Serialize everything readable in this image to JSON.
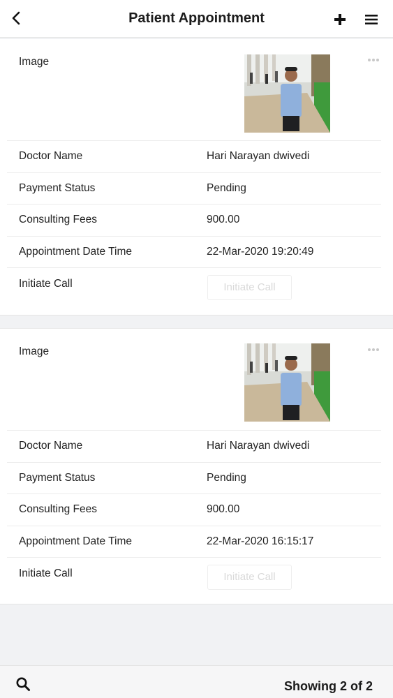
{
  "header": {
    "title": "Patient Appointment",
    "back_icon": "chevron-left-icon",
    "add_icon": "plus-icon",
    "menu_icon": "hamburger-menu-icon"
  },
  "labels": {
    "image": "Image",
    "doctor_name": "Doctor Name",
    "payment_status": "Payment Status",
    "consulting_fees": "Consulting Fees",
    "appointment_date_time": "Appointment Date Time",
    "initiate_call": "Initiate Call"
  },
  "appointments": [
    {
      "doctor_name": "Hari Narayan dwivedi",
      "payment_status": "Pending",
      "consulting_fees": "900.00",
      "appointment_date_time": "22-Mar-2020 19:20:49",
      "call_button": "Initiate Call"
    },
    {
      "doctor_name": "Hari Narayan dwivedi",
      "payment_status": "Pending",
      "consulting_fees": "900.00",
      "appointment_date_time": "22-Mar-2020 16:15:17",
      "call_button": "Initiate Call"
    }
  ],
  "footer": {
    "search_icon": "search-icon",
    "showing": "Showing 2 of 2"
  },
  "colors": {
    "background": "#f1f2f4",
    "card": "#ffffff",
    "disabled_text": "#d9d9d9"
  }
}
